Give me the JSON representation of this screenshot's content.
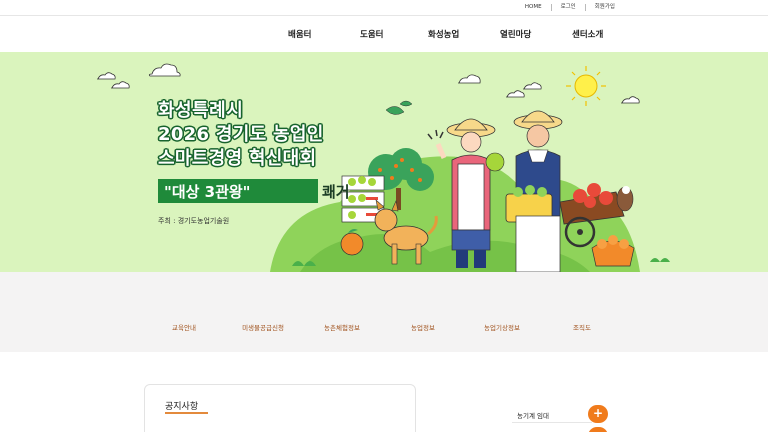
{
  "util_links": [
    "HOME",
    "로그인",
    "회원가입"
  ],
  "gnb": [
    "배움터",
    "도움터",
    "화성농업",
    "열린마당",
    "센터소개"
  ],
  "hero": {
    "title_line1": "화성특례시",
    "title_line2": "2026 경기도 농업인",
    "title_line3": "스마트경영 혁신대회",
    "award_main": "\"대상 3관왕\"",
    "award_suffix": "쾌거",
    "host": "주최 : 경기도농업기술원",
    "colors": {
      "background": "#daf4bd",
      "accent": "#1f8a3a"
    }
  },
  "quick_menu": [
    "교육안내",
    "미생물공급신청",
    "농촌체험정보",
    "농업정보",
    "농업기상정보",
    "조직도"
  ],
  "notice": {
    "title": "공지사항"
  },
  "side_list": {
    "item1": "농기계 임대",
    "plus_icon": "+"
  },
  "colors": {
    "orange": "#f07b1c",
    "quick_text": "#a0521d"
  }
}
